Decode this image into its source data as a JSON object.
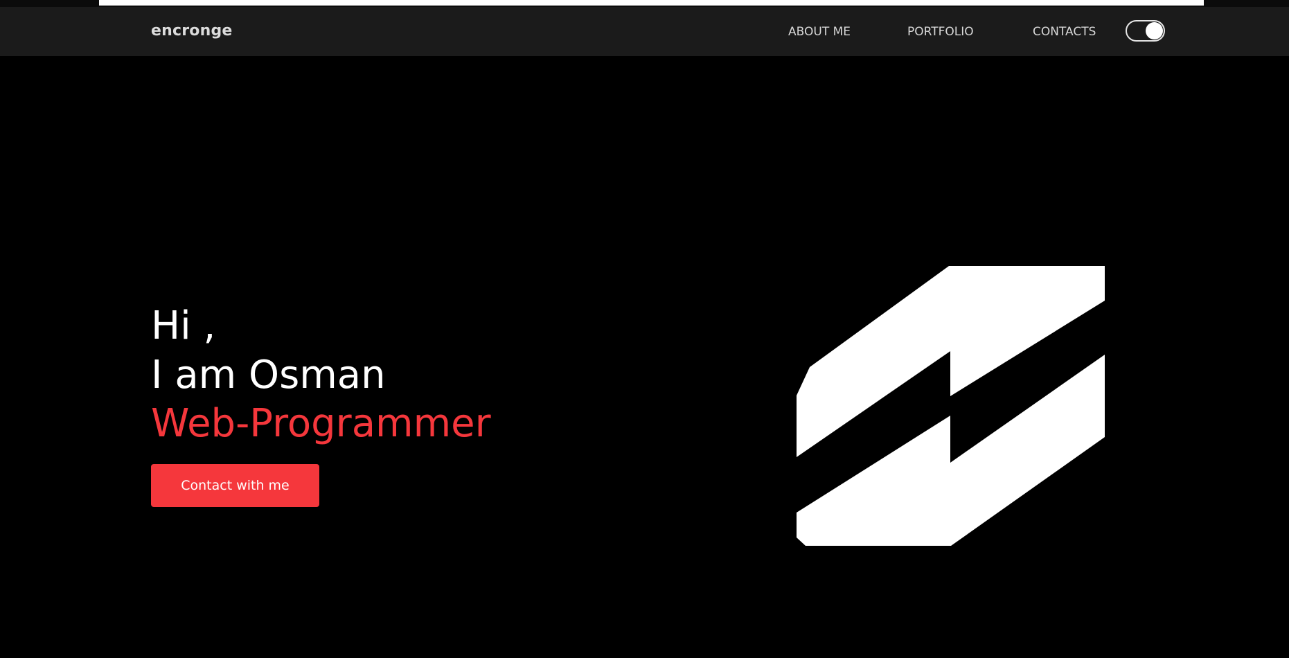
{
  "header": {
    "logo_text": "encronge",
    "nav": [
      {
        "label": "ABOUT ME"
      },
      {
        "label": "PORTFOLIO"
      },
      {
        "label": "CONTACTS"
      }
    ],
    "theme_toggle": {
      "state": "on",
      "icon": "toggle-switch-icon"
    }
  },
  "hero": {
    "greeting": "Hi ,",
    "name_line": "I am Osman",
    "role": "Web-Programmer",
    "cta_label": "Contact with me",
    "mark_icon": "brand-logo-mark-icon"
  },
  "colors": {
    "background": "#000000",
    "navbar": "#1b1b1b",
    "accent": "#f5373c",
    "text": "#ffffff"
  }
}
